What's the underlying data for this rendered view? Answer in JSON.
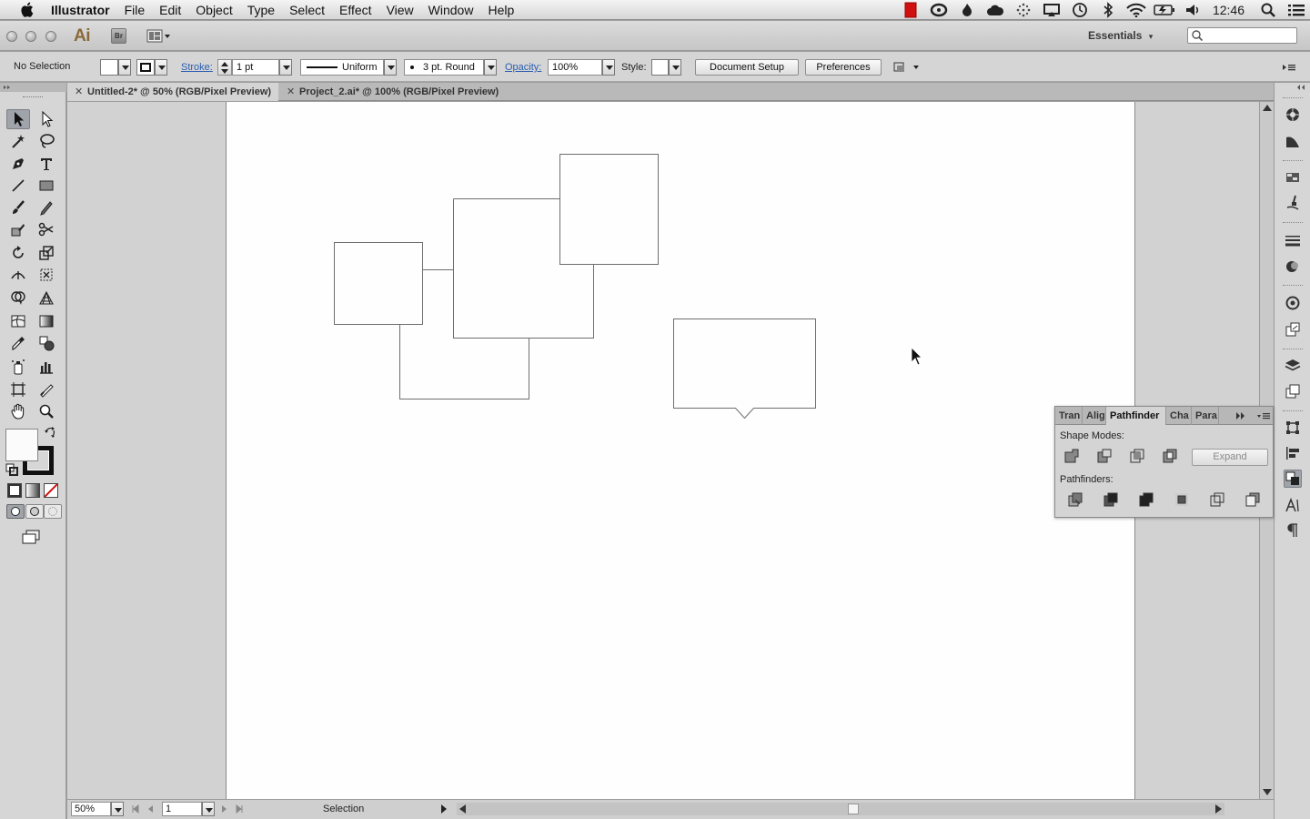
{
  "menubar": {
    "app_name": "Illustrator",
    "items": [
      "File",
      "Edit",
      "Object",
      "Type",
      "Select",
      "Effect",
      "View",
      "Window",
      "Help"
    ],
    "clock": "12:46"
  },
  "appbar": {
    "logo": "Ai",
    "bridge_label": "Br",
    "workspace": "Essentials"
  },
  "controlbar": {
    "selection_label": "No Selection",
    "stroke_label": "Stroke:",
    "stroke_weight": "1 pt",
    "stroke_profile": "Uniform",
    "brush": "3 pt. Round",
    "opacity_label": "Opacity:",
    "opacity": "100%",
    "style_label": "Style:",
    "document_setup": "Document Setup",
    "preferences": "Preferences"
  },
  "tabs": [
    {
      "label": "Untitled-2* @ 50% (RGB/Pixel Preview)",
      "active": true
    },
    {
      "label": "Project_2.ai* @ 100% (RGB/Pixel Preview)",
      "active": false
    }
  ],
  "pathfinder": {
    "tabs": [
      "Tran",
      "Alig",
      "Pathfinder",
      "Cha",
      "Para"
    ],
    "shape_modes_label": "Shape Modes:",
    "pathfinders_label": "Pathfinders:",
    "expand_label": "Expand"
  },
  "statusbar": {
    "zoom": "50%",
    "page": "1",
    "tool_status": "Selection"
  },
  "colors": {
    "ui_gray": "#d6d6d6",
    "tab_bar": "#b9b9b9",
    "link_blue": "#2a5db0",
    "none_red": "#d01010"
  }
}
